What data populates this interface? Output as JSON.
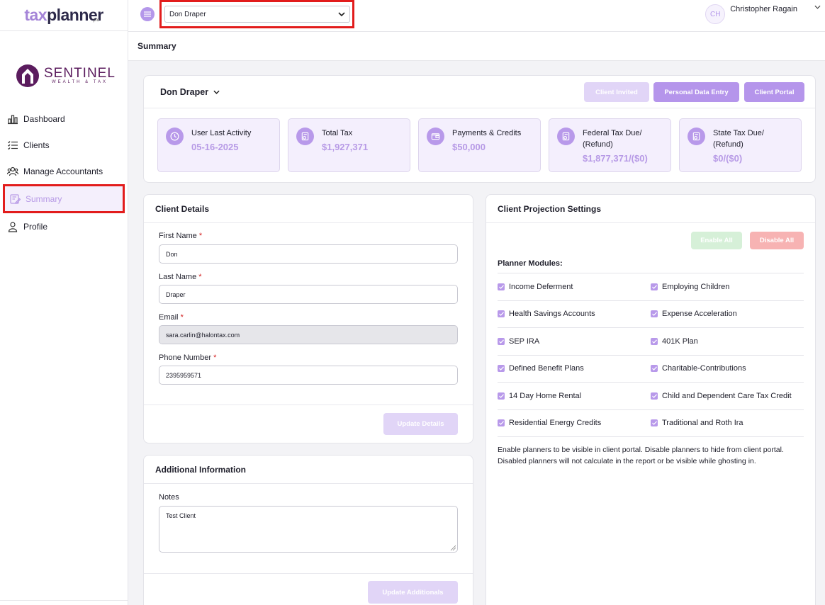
{
  "app": {
    "logo_tax": "tax",
    "logo_planner": "planner",
    "logo_pro": "pro",
    "brand_name": "SENTINEL",
    "brand_sub": "WEALTH & TAX"
  },
  "sidebar": {
    "items": [
      {
        "label": "Dashboard",
        "icon": "bar-chart-icon"
      },
      {
        "label": "Clients",
        "icon": "list-icon"
      },
      {
        "label": "Manage Accountants",
        "icon": "users-icon"
      },
      {
        "label": "Summary",
        "icon": "edit-icon"
      },
      {
        "label": "Profile",
        "icon": "user-icon"
      }
    ]
  },
  "topbar": {
    "client_select": "Don Draper",
    "avatar_initials": "CH",
    "user_name": "Christopher Ragain"
  },
  "page": {
    "title": "Summary"
  },
  "summary": {
    "client_name": "Don Draper",
    "buttons": {
      "invited": "Client Invited",
      "personal": "Personal Data Entry",
      "portal": "Client Portal"
    },
    "stats": [
      {
        "label": "User Last Activity",
        "value": "05-16-2025"
      },
      {
        "label": "Total Tax",
        "value": "$1,927,371"
      },
      {
        "label": "Payments & Credits",
        "value": "$50,000"
      },
      {
        "label": "Federal Tax Due/ (Refund)",
        "value": "$1,877,371/($0)"
      },
      {
        "label": "State Tax Due/ (Refund)",
        "value": "$0/($0)"
      }
    ]
  },
  "client_details": {
    "title": "Client Details",
    "first_name_label": "First Name",
    "first_name": "Don",
    "last_name_label": "Last Name",
    "last_name": "Draper",
    "email_label": "Email",
    "email": "sara.carlin@halontax.com",
    "phone_label": "Phone Number",
    "phone": "2395959571",
    "required_mark": "*",
    "update_button": "Update Details"
  },
  "additional": {
    "title": "Additional Information",
    "notes_label": "Notes",
    "notes": "Test Client",
    "update_button": "Update Additionals"
  },
  "projection": {
    "title": "Client Projection Settings",
    "enable_all": "Enable All",
    "disable_all": "Disable All",
    "modules_title": "Planner Modules:",
    "modules": [
      [
        "Income Deferment",
        "Employing Children"
      ],
      [
        "Health Savings Accounts",
        "Expense Acceleration"
      ],
      [
        "SEP IRA",
        "401K Plan"
      ],
      [
        "Defined Benefit Plans",
        "Charitable-Contributions"
      ],
      [
        "14 Day Home Rental",
        "Child and Dependent Care Tax Credit"
      ],
      [
        "Residential Energy Credits",
        "Traditional and Roth Ira"
      ]
    ],
    "note": "Enable planners to be visible in client portal. Disable planners to hide from client portal. Disabled planners will not calculate in the report or be visible while ghosting in."
  },
  "colors": {
    "accent": "#b595eb",
    "accent_soft": "#e1d5f7",
    "highlight_red": "#e21c1c",
    "value_purple": "#b79ae6"
  }
}
